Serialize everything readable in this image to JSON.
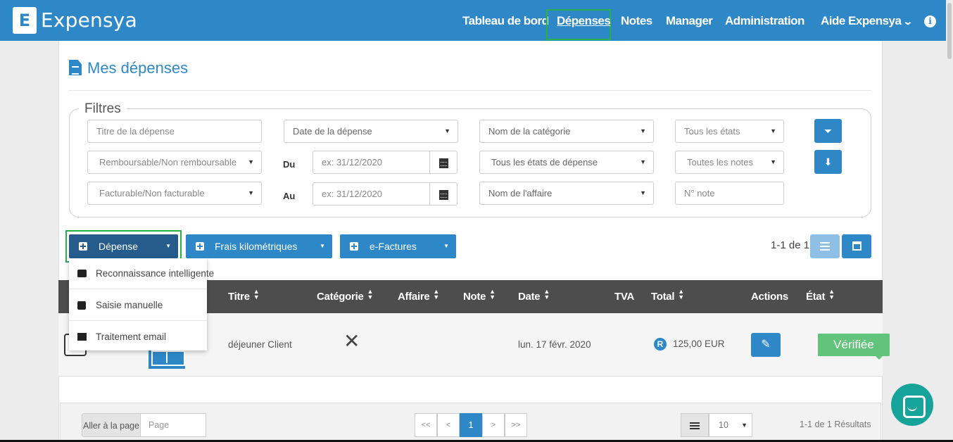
{
  "header": {
    "logo_letter": "E",
    "app_name": "Expensya",
    "nav": {
      "dashboard": "Tableau de bord",
      "expenses": "Dépenses",
      "notes": "Notes",
      "manager": "Manager",
      "administration": "Administration",
      "help": "Aide Expensya"
    },
    "info_glyph": "i"
  },
  "page": {
    "title": "Mes dépenses"
  },
  "filters": {
    "legend": "Filtres",
    "title_placeholder": "Titre de la dépense",
    "date_select": "Date de la dépense",
    "category_select": "Nom de la catégorie",
    "states_select": "Tous les états",
    "refundable_select": "Remboursable/Non remboursable",
    "from_label": "Du",
    "from_placeholder": "ex: 31/12/2020",
    "expense_states_select": "Tous les états de dépense",
    "notes_select": "Toutes les notes",
    "billable_select": "Facturable/Non facturable",
    "to_label": "Au",
    "to_placeholder": "ex: 31/12/2020",
    "business_select": "Nom de l'affaire",
    "note_number_placeholder": "N° note"
  },
  "actions": {
    "expense_button": "Dépense",
    "mileage_button": "Frais kilométriques",
    "einvoice_button": "e-Factures",
    "count": "1-1 de 1"
  },
  "add_menu": {
    "items": [
      {
        "label": "Reconnaissance intelligente",
        "icon": "camera-icon"
      },
      {
        "label": "Saisie manuelle",
        "icon": "plus-square-icon"
      },
      {
        "label": "Traitement email",
        "icon": "envelope-icon"
      }
    ]
  },
  "table": {
    "headers": {
      "title": "Titre",
      "category": "Catégorie",
      "business": "Affaire",
      "note": "Note",
      "date": "Date",
      "vat": "TVA",
      "total": "Total",
      "actions": "Actions",
      "state": "État"
    },
    "rows": [
      {
        "title": "déjeuner Client",
        "category_icon": "restaurant-icon",
        "date": "lun. 17 févr. 2020",
        "refund_badge": "R",
        "total": "125,00 EUR",
        "state": "Vérifiée"
      }
    ]
  },
  "footer": {
    "goto_label": "Aller à la page",
    "goto_placeholder": "Page",
    "pages": {
      "first": "<<",
      "prev": "<",
      "current": "1",
      "next": ">",
      "last": ">>"
    },
    "per_page": "10",
    "results": "1-1 de 1 Résultats"
  },
  "colors": {
    "primary": "#2e88c8",
    "dark_button": "#255c8c",
    "highlight": "#27b04b",
    "verified": "#62c37a",
    "table_header": "#4d4d4d",
    "chat": "#16a39a"
  }
}
